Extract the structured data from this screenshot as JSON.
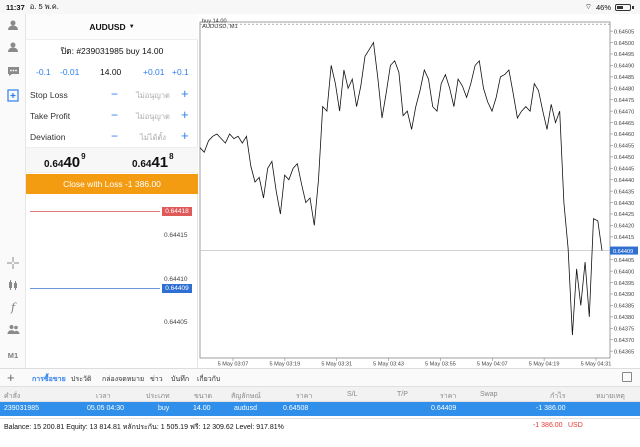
{
  "status_bar": {
    "time": "11:37",
    "date": "อ. 5 พ.ค.",
    "battery": "46%"
  },
  "toolbar": {
    "icons": [
      "person-settings-icon",
      "person-icon",
      "chat-icon",
      "new-order-icon",
      "crosshair-icon",
      "candlestick-icon",
      "function-icon",
      "people-icon"
    ],
    "timeframe": "M1"
  },
  "order_panel": {
    "symbol": "AUDUSD",
    "title": "ปิด: #239031985 buy 14.00",
    "volume": {
      "dec_large": "-0.1",
      "dec_small": "-0.01",
      "value": "14.00",
      "inc_small": "+0.01",
      "inc_large": "+0.1"
    },
    "stop_loss": {
      "label": "Stop Loss",
      "value": "ไม่อนุญาต"
    },
    "take_profit": {
      "label": "Take Profit",
      "value": "ไม่อนุญาต"
    },
    "deviation": {
      "label": "Deviation",
      "value": "ไม่ได้ตั้ง"
    },
    "bid": {
      "main": "0.64",
      "big": "40",
      "sup": "9"
    },
    "ask": {
      "main": "0.64",
      "big": "41",
      "sup": "8"
    },
    "close_label": "Close with Loss -1 386.00",
    "mini_scale": {
      "ask_tag": "0.64418",
      "bid_tag": "0.64409",
      "labels": [
        "0.64415",
        "0.64410",
        "0.64405"
      ]
    }
  },
  "chart": {
    "title": "AUDUSD, M1",
    "trade_label": "buy 14.00",
    "current_price_tag": "0.64409",
    "colors": {
      "price_tag": "#2f6fd1",
      "ask_tag": "#e05a5a",
      "close_button": "#f39c12",
      "selected_row": "#2f8fea",
      "loss": "#e53935"
    }
  },
  "chart_data": {
    "type": "line",
    "title": "AUDUSD, M1",
    "xlabel": "",
    "ylabel": "",
    "y_ticks": [
      "0.64505",
      "0.64500",
      "0.64495",
      "0.64490",
      "0.64485",
      "0.64480",
      "0.64475",
      "0.64470",
      "0.64465",
      "0.64460",
      "0.64455",
      "0.64450",
      "0.64445",
      "0.64440",
      "0.64435",
      "0.64430",
      "0.64425",
      "0.64420",
      "0.64415",
      "0.64410",
      "0.64405",
      "0.64400",
      "0.64395",
      "0.64390",
      "0.64385",
      "0.64380",
      "0.64375",
      "0.64370",
      "0.64365"
    ],
    "x_ticks": [
      "5 May 03:07",
      "5 May 03:19",
      "5 May 03:31",
      "5 May 03:43",
      "5 May 03:55",
      "5 May 04:07",
      "5 May 04:19",
      "5 May 04:31"
    ],
    "ylim": [
      0.64362,
      0.64509
    ],
    "trade_level": 0.64508,
    "current_level": 0.64409,
    "values": [
      0.64454,
      0.64452,
      0.64457,
      0.64459,
      0.6446,
      0.64458,
      0.64456,
      0.6446,
      0.64458,
      0.64459,
      0.64456,
      0.64459,
      0.64446,
      0.64439,
      0.64441,
      0.64432,
      0.64445,
      0.64448,
      0.64435,
      0.64425,
      0.64442,
      0.6444,
      0.64445,
      0.64447,
      0.64438,
      0.6443,
      0.64432,
      0.6442,
      0.6444,
      0.64472,
      0.6447,
      0.6449,
      0.64482,
      0.6447,
      0.64488,
      0.6448,
      0.64484,
      0.64472,
      0.64481,
      0.64494,
      0.64497,
      0.645,
      0.64485,
      0.64467,
      0.64478,
      0.6449,
      0.64492,
      0.64487,
      0.64468,
      0.6447,
      0.64462,
      0.64472,
      0.64479,
      0.64488,
      0.64484,
      0.64472,
      0.6447,
      0.64482,
      0.64486,
      0.6448,
      0.64472,
      0.64484,
      0.64481,
      0.64476,
      0.64482,
      0.6449,
      0.64492,
      0.6448,
      0.64474,
      0.6447,
      0.64476,
      0.64485,
      0.64486,
      0.64488,
      0.64478,
      0.64467,
      0.6447,
      0.64472,
      0.6447,
      0.64482,
      0.64479,
      0.6447,
      0.64462,
      0.64473,
      0.64465,
      0.6447,
      0.6443,
      0.6441,
      0.64372,
      0.64401,
      0.64385,
      0.64404,
      0.6438,
      0.64423,
      0.64422,
      0.64409
    ]
  },
  "terminal": {
    "tabs": [
      "การซื้อขาย",
      "ประวัติ",
      "กล่องจดหมาย",
      "ข่าว",
      "บันทึก",
      "เกี่ยวกับ"
    ],
    "columns": [
      "คำสั่ง",
      "เวลา",
      "ประเภท",
      "ขนาด",
      "สัญลักษณ์",
      "ราคา",
      "S/L",
      "T/P",
      "ราคา",
      "Swap",
      "กำไร",
      "หมายเหตุ"
    ],
    "rows": [
      {
        "order": "239031985",
        "time": "05.05 04:30",
        "type": "buy",
        "size": "14.00",
        "symbol": "audusd",
        "price": "0.64508",
        "sl": "",
        "tp": "",
        "current": "0.64409",
        "swap": "",
        "profit": "-1 386.00",
        "comment": ""
      }
    ],
    "balance_text": "Balance: 15 200.81 Equity: 13 814.81 หลักประกัน: 1 505.19 ฟรี: 12 309.62 Level: 917.81%",
    "total_profit": "-1 386.00",
    "currency": "USD"
  }
}
